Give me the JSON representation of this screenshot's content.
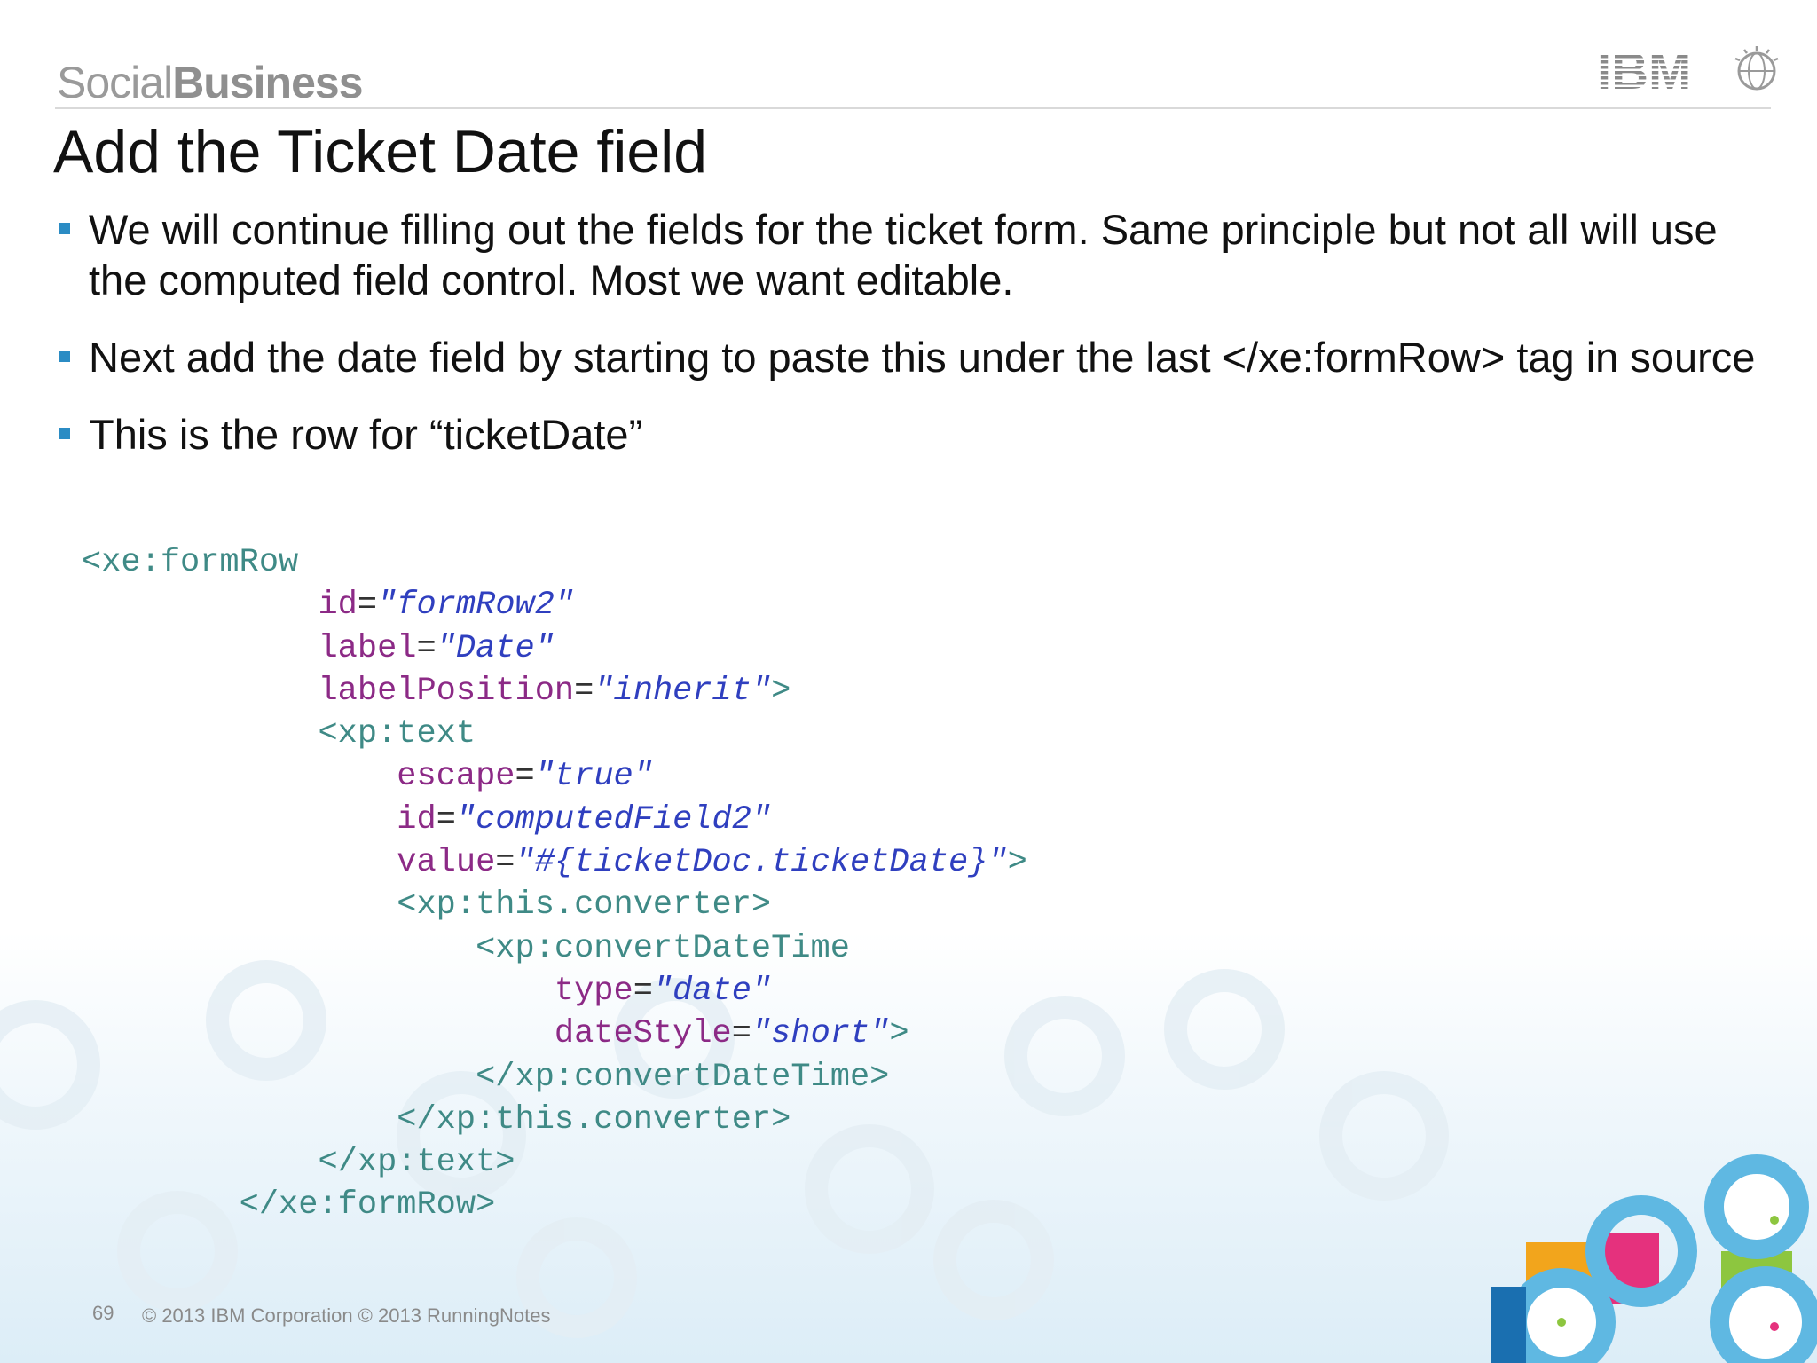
{
  "header": {
    "brand_light": "Social",
    "brand_bold": "Business",
    "logo_text": "IBM"
  },
  "title": "Add the Ticket Date field",
  "bullets": [
    "We will continue filling out the fields for the ticket form.  Same principle but not all will use the computed field control.  Most we want editable.",
    "Next add the date field by starting to paste this under the last </xe:formRow> tag in source",
    "This is the row for “ticketDate”"
  ],
  "code_lines": [
    "<xe:formRow",
    "            id=\"formRow2\"",
    "            label=\"Date\"",
    "            labelPosition=\"inherit\">",
    "            <xp:text",
    "                escape=\"true\"",
    "                id=\"computedField2\"",
    "                value=\"#{ticketDoc.ticketDate}\">",
    "                <xp:this.converter>",
    "                    <xp:convertDateTime",
    "                        type=\"date\"",
    "                        dateStyle=\"short\">",
    "                    </xp:convertDateTime>",
    "                </xp:this.converter>",
    "            </xp:text>",
    "        </xe:formRow>"
  ],
  "footer": {
    "page_number": "69",
    "copyright": "© 2013 IBM Corporation  © 2013 RunningNotes"
  },
  "colors": {
    "accent": "#2b8cc4",
    "code_tag": "#3f8a86",
    "code_attr": "#8c2a86",
    "code_string": "#2f3fbf"
  }
}
